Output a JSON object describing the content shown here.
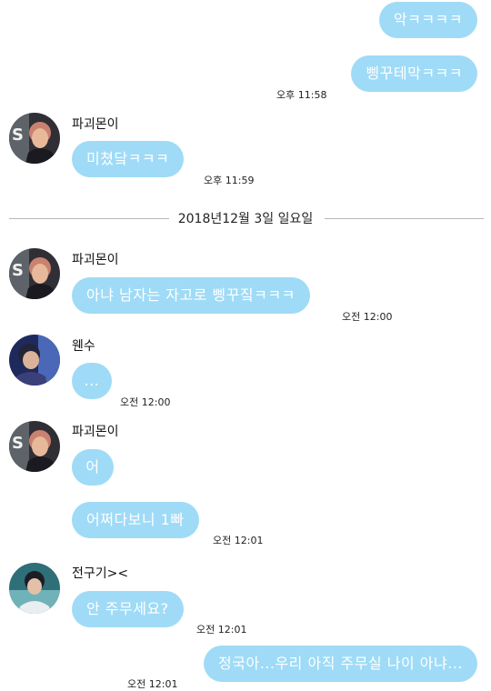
{
  "messages": {
    "m1": "악ㅋㅋㅋㅋ",
    "m2": "삥꾸테막ㅋㅋㅋ",
    "m2_time": "오후 11:58",
    "m3_sender": "파괴몬이",
    "m3": "미쳤닼ㅋㅋㅋ",
    "m3_time": "오후 11:59",
    "date_separator": "2018년12월 3일 일요일",
    "m4_sender": "파괴몬이",
    "m4": "아냐 남자는 자고로 삥꾸짘ㅋㅋㅋ",
    "m4_time": "오전 12:00",
    "m5_sender": "웬수",
    "m5": "...",
    "m5_time": "오전 12:00",
    "m6_sender": "파괴몬이",
    "m6a": "어",
    "m6b": "어쩌다보니 1빠",
    "m6_time": "오전 12:01",
    "m7_sender": "전구기><",
    "m7": "안 주무세요?",
    "m7_time": "오전 12:01",
    "m8": "정국아...우리 아직 주무실 나이 아냐...",
    "m8_time": "오전 12:01"
  },
  "colors": {
    "bubble": "#9fdaf6",
    "bubble_text": "#ffffff",
    "divider": "#b8b8b8"
  },
  "icons": {
    "avatar_pink": "avatar-pink-hair-icon",
    "avatar_blue": "avatar-blue-tone-icon",
    "avatar_teal": "avatar-teal-tone-icon"
  }
}
